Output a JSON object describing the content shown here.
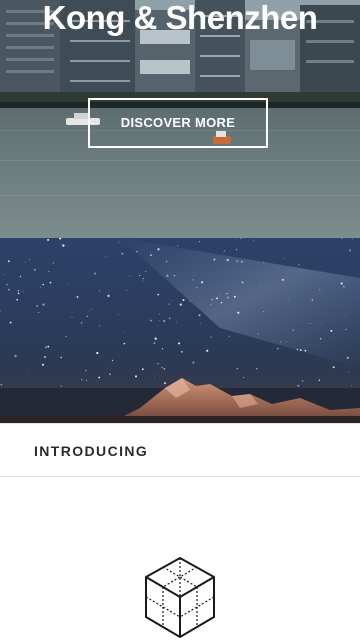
{
  "hero": {
    "title": "Kong & Shenzhen",
    "cta_label": "DISCOVER MORE",
    "image_icon": "harbour-skyline-photo"
  },
  "banner": {
    "image_icon": "starry-night-mountain-photo"
  },
  "intro": {
    "label": "INTRODUCING",
    "icon": "wireframe-cube-icon"
  },
  "colors": {
    "water": "#6f8084",
    "sky_night": "#2a3c5c",
    "mountain_glow": "#c9856a",
    "text_dark": "#2b2b2b",
    "divider": "#e3e3e3"
  }
}
